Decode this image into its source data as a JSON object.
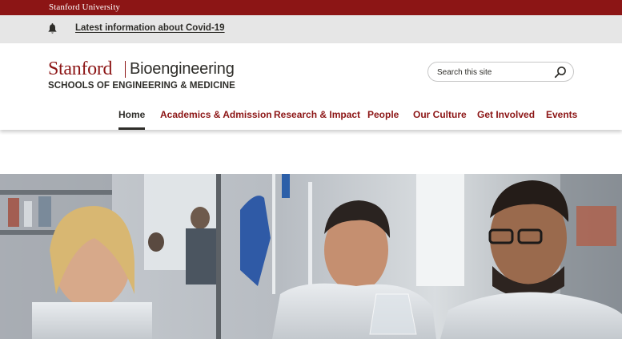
{
  "global_bar": {
    "label": "Stanford University",
    "color": "#8c1515"
  },
  "alert": {
    "icon": "bell-icon",
    "text": "Latest information about Covid-19"
  },
  "header": {
    "wordmark": "Stanford",
    "department": "Bioengineering",
    "schools": "SCHOOLS OF ENGINEERING & MEDICINE"
  },
  "search": {
    "placeholder": "Search this site",
    "value": "",
    "icon": "search-icon"
  },
  "nav": {
    "active": "Home",
    "items": [
      {
        "label": "Home"
      },
      {
        "label": "Academics & Admission"
      },
      {
        "label": "Research & Impact"
      },
      {
        "label": "People"
      },
      {
        "label": "Our Culture"
      },
      {
        "label": "Get Involved"
      },
      {
        "label": "Events"
      }
    ]
  },
  "colors": {
    "cardinal": "#8c1515",
    "text": "#2e2d29",
    "alert_bg": "#e6e6e6"
  }
}
